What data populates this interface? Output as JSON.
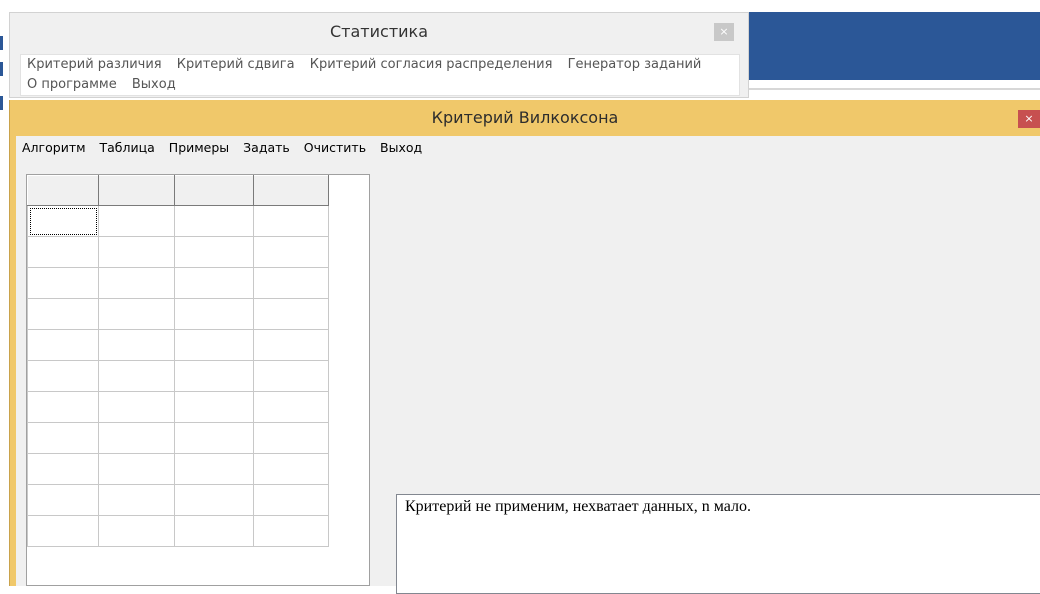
{
  "parent_window": {
    "title": "Статистика",
    "close_label": "×",
    "menu_row1": [
      "Критерий различия",
      "Критерий сдвига",
      "Критерий согласия распределения",
      "Генератор заданий"
    ],
    "menu_row2": [
      "О программе",
      "Выход"
    ]
  },
  "dialog": {
    "title": "Критерий Вилкоксона",
    "close_label": "×",
    "menu": [
      "Алгоритм",
      "Таблица",
      "Примеры",
      "Задать",
      "Очистить",
      "Выход"
    ],
    "grid": {
      "columns": [
        "",
        "",
        "",
        ""
      ],
      "rows": [
        [
          "",
          "",
          "",
          ""
        ],
        [
          "",
          "",
          "",
          ""
        ],
        [
          "",
          "",
          "",
          ""
        ],
        [
          "",
          "",
          "",
          ""
        ],
        [
          "",
          "",
          "",
          ""
        ],
        [
          "",
          "",
          "",
          ""
        ],
        [
          "",
          "",
          "",
          ""
        ],
        [
          "",
          "",
          "",
          ""
        ],
        [
          "",
          "",
          "",
          ""
        ],
        [
          "",
          "",
          "",
          ""
        ],
        [
          "",
          "",
          "",
          ""
        ]
      ]
    },
    "output_text": "Критерий не применим, нехватает данных, n мало."
  },
  "colors": {
    "dialog_frame": "#f0c86a",
    "dialog_close": "#c75050",
    "accent_blue": "#2b5797"
  }
}
